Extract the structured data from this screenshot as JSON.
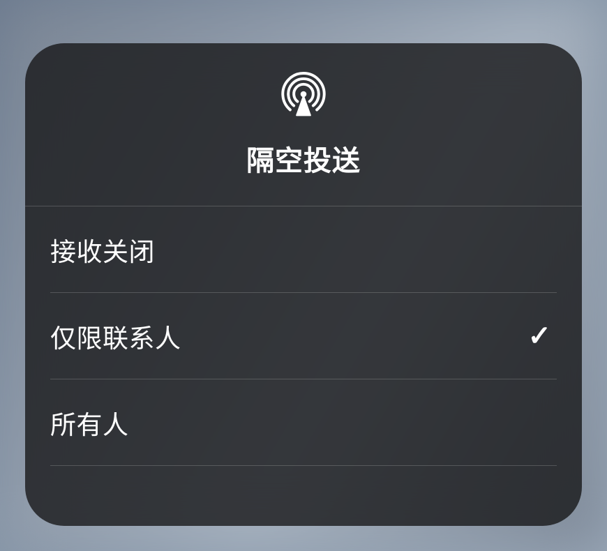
{
  "header": {
    "title": "隔空投送"
  },
  "options": [
    {
      "label": "接收关闭",
      "selected": false
    },
    {
      "label": "仅限联系人",
      "selected": true
    },
    {
      "label": "所有人",
      "selected": false
    }
  ]
}
